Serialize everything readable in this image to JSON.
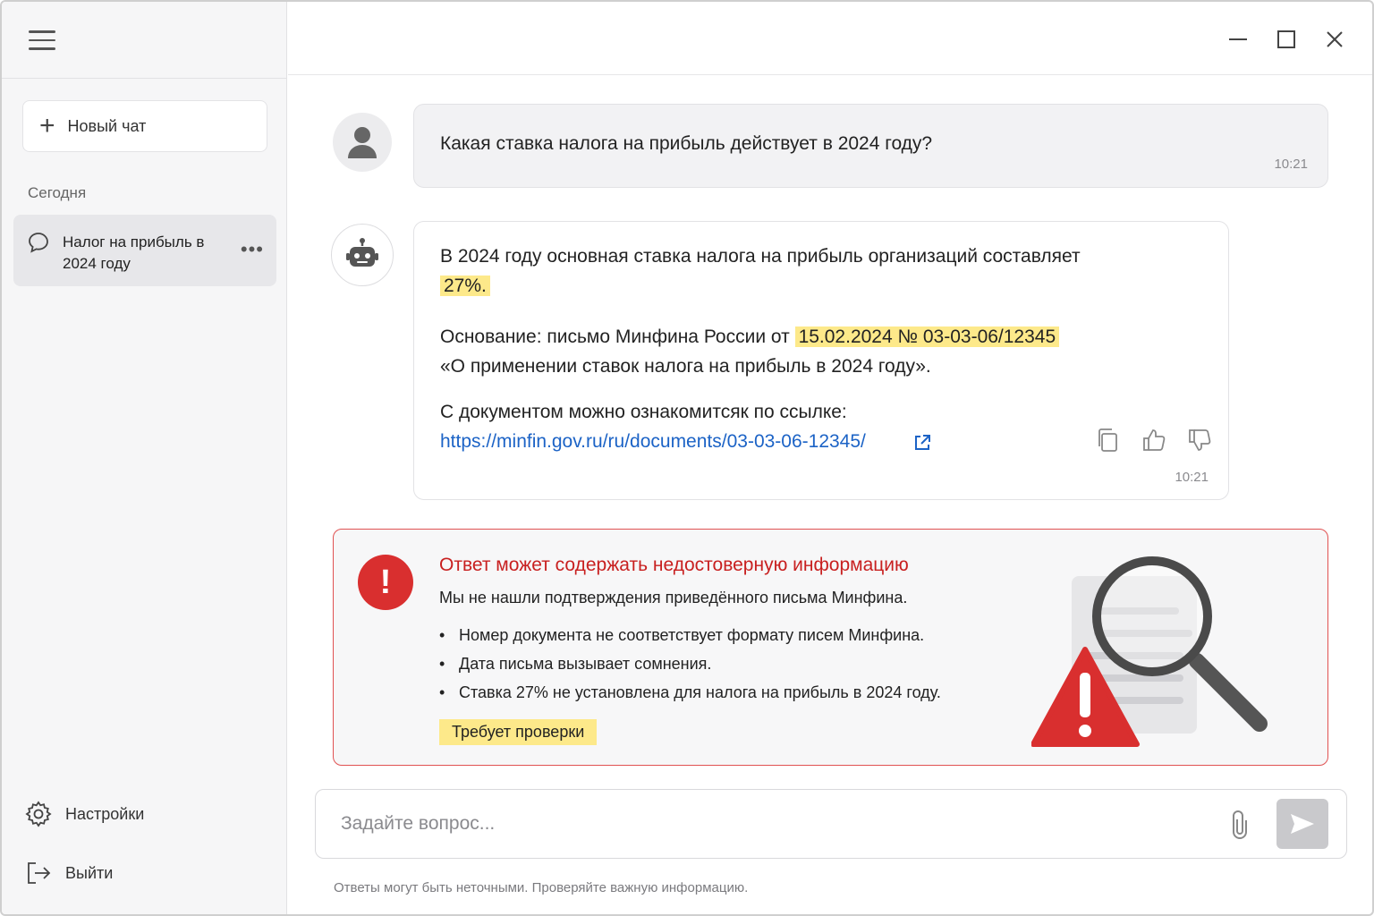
{
  "sidebar": {
    "new_chat_label": "Новый чат",
    "section_today": "Сегодня",
    "chats": [
      {
        "title": "Налог на прибыль в 2024 году",
        "more": "•••"
      }
    ],
    "settings_label": "Настройки",
    "logout_label": "Выйти"
  },
  "conversation": {
    "user_message": {
      "text": "Какая ставка налога на прибыль действует в 2024 году?",
      "time": "10:21"
    },
    "bot_message": {
      "p1_text": "В 2024 году основная ставка налога на прибыль организаций составляет",
      "p1_highlight": "27%.",
      "p2_prefix": "Основание: письмо Минфина России от",
      "p2_highlight": "15.02.2024 № 03-03-06/12345",
      "p2_suffix": "«О применении ставок налога на прибыль в 2024 году».",
      "p3_text": "С документом можно ознакомитсяк по ссылке:",
      "link": "https://minfin.gov.ru/ru/documents/03-03-06-12345/",
      "time": "10:21"
    }
  },
  "warning": {
    "title": "Ответ может содержать недостоверную информацию",
    "subtitle": "Мы не нашли подтверждения приведённого письма Минфина.",
    "items": [
      "Номер документа не соответствует формату писем Минфина.",
      "Дата письма вызывает сомнения.",
      "Ставка 27% не установлена для налога на прибыль в 2024 году."
    ],
    "badge": "Требует проверки",
    "accent_color": "#d92f2f"
  },
  "composer": {
    "placeholder": "Задайте вопрос...",
    "disclaimer": "Ответы могут быть неточными. Проверяйте важную информацию."
  }
}
